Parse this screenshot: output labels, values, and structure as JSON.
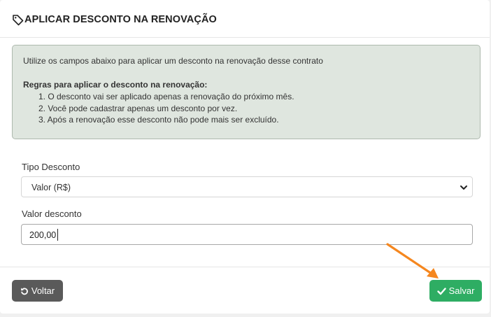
{
  "header": {
    "title": "APLICAR DESCONTO NA RENOVAÇÃO",
    "icon": "tag-icon"
  },
  "info": {
    "intro": "Utilize os campos abaixo para aplicar um desconto na renovação desse contrato",
    "rules_title": "Regras para aplicar o desconto na renovação:",
    "rules": [
      "1. O desconto vai ser aplicado apenas a renovação do próximo mês.",
      "2. Você pode cadastrar apenas um desconto por vez.",
      "3. Após a renovação esse desconto não pode mais ser excluído."
    ]
  },
  "form": {
    "tipo_label": "Tipo Desconto",
    "tipo_value": "Valor (R$)",
    "valor_label": "Valor desconto",
    "valor_value": "200,00"
  },
  "buttons": {
    "back_label": "Voltar",
    "back_icon": "undo-icon",
    "save_label": "Salvar",
    "save_icon": "check-icon"
  },
  "colors": {
    "info_bg": "#dfe6df",
    "save": "#2ead63",
    "back": "#5a5a5a",
    "annotation_arrow": "#f5871f"
  }
}
